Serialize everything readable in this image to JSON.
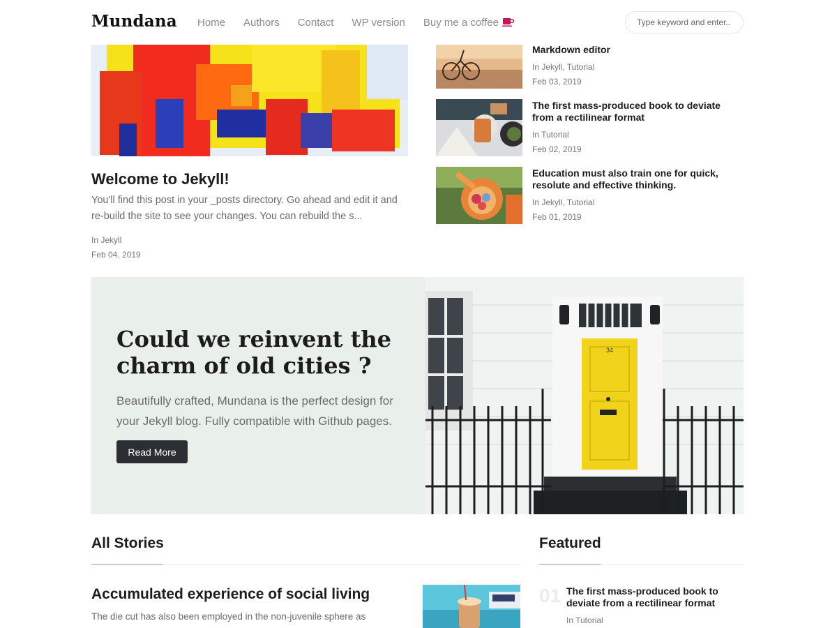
{
  "brand": "Mundana",
  "nav": {
    "links": [
      "Home",
      "Authors",
      "Contact",
      "WP version",
      "Buy me a coffee"
    ],
    "search_placeholder": "Type keyword and enter.."
  },
  "main_post": {
    "title": "Welcome to Jekyll!",
    "excerpt": "You'll find this post in your _posts directory. Go ahead and edit it and re-build the site to see your changes. You can rebuild the s...",
    "category": "In Jekyll",
    "date": "Feb 04, 2019"
  },
  "side_posts": [
    {
      "title": "Markdown editor",
      "category": "In Jekyll, Tutorial",
      "date": "Feb 03, 2019"
    },
    {
      "title": "The first mass-produced book to deviate from a rectilinear format",
      "category": "In Tutorial",
      "date": "Feb 02, 2019"
    },
    {
      "title": "Education must also train one for quick, resolute and effective thinking.",
      "category": "In Jekyll, Tutorial",
      "date": "Feb 01, 2019"
    }
  ],
  "jumbotron": {
    "title": "Could we reinvent the charm of old cities ?",
    "text": "Beautifully crafted, Mundana is the perfect design for your Jekyll blog. Fully compatible with Github pages.",
    "button": "Read More",
    "door_number": "34"
  },
  "all_stories": {
    "heading": "All Stories",
    "items": [
      {
        "title": "Accumulated experience of social living",
        "excerpt": "The die cut has also been employed in the non-juvenile sphere as"
      }
    ]
  },
  "featured": {
    "heading": "Featured",
    "items": [
      {
        "number": "01",
        "title": "The first mass-produced book to deviate from a rectilinear format",
        "category": "In Tutorial"
      }
    ]
  },
  "colors": {
    "accent_coffee": "#c2185b",
    "jumbotron_bg": "#e9f0ec",
    "button_bg": "#2b2e33",
    "door_yellow": "#f2d31b"
  }
}
